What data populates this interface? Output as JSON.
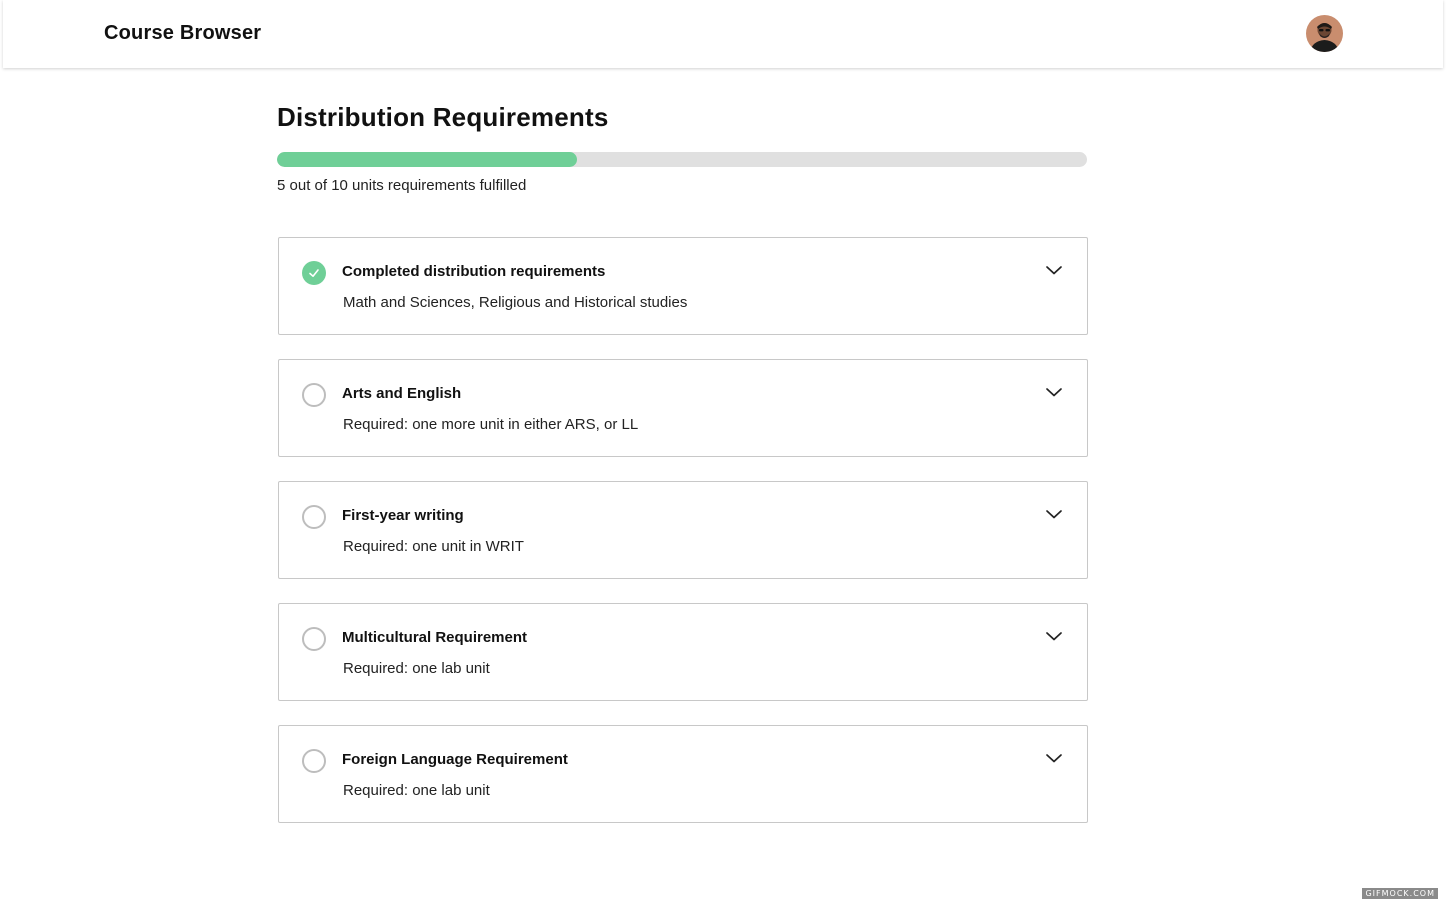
{
  "header": {
    "title": "Course Browser",
    "avatar_icon": "user-avatar-icon"
  },
  "main": {
    "title": "Distribution Requirements",
    "progress": {
      "fulfilled": 5,
      "total": 10,
      "fraction": 0.5,
      "text": "5 out of 10 units requirements fulfilled",
      "fill_color": "#6fcf97",
      "track_color": "#e0e0e0"
    },
    "requirements": [
      {
        "title": "Completed distribution requirements",
        "description": "Math and Sciences, Religious and Historical studies",
        "status": "complete",
        "status_icon": "check-circle-icon",
        "toggle_icon": "chevron-down-icon"
      },
      {
        "title": "Arts and English",
        "description": "Required: one more unit in either ARS, or LL",
        "status": "incomplete",
        "status_icon": "empty-circle-icon",
        "toggle_icon": "chevron-down-icon"
      },
      {
        "title": "First-year writing",
        "description": "Required: one unit in WRIT",
        "status": "incomplete",
        "status_icon": "empty-circle-icon",
        "toggle_icon": "chevron-down-icon"
      },
      {
        "title": "Multicultural Requirement",
        "description": "Required: one lab unit",
        "status": "incomplete",
        "status_icon": "empty-circle-icon",
        "toggle_icon": "chevron-down-icon"
      },
      {
        "title": "Foreign Language Requirement",
        "description": "Required: one lab unit",
        "status": "incomplete",
        "status_icon": "empty-circle-icon",
        "toggle_icon": "chevron-down-icon"
      }
    ]
  },
  "watermark": "GIFMOCK.COM"
}
